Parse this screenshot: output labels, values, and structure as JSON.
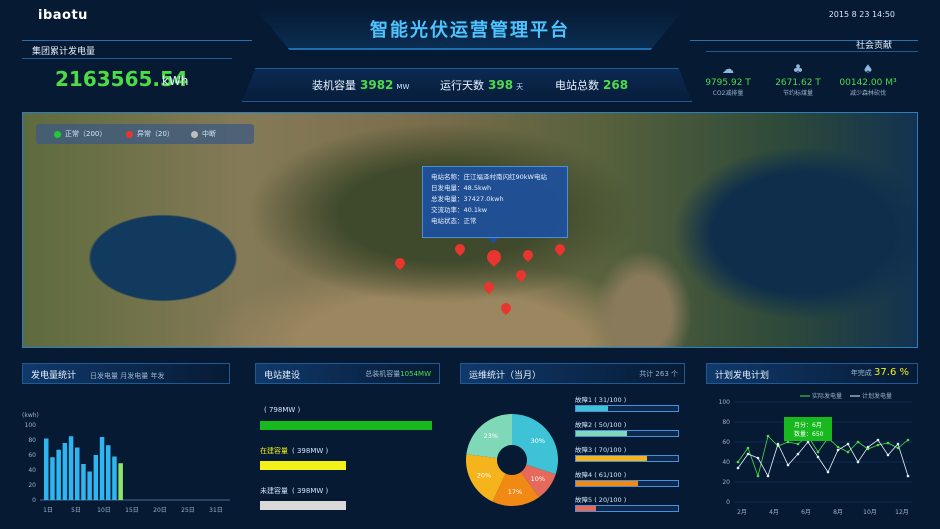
{
  "header": {
    "logo": "ibaotu",
    "title": "智能光伏运营管理平台",
    "datetime": "2015 8 23 14:50"
  },
  "left_stat": {
    "label": "集团累计发电量",
    "value": "2163565.54",
    "unit": "kWh"
  },
  "stats": [
    {
      "label": "装机容量",
      "value": "3982",
      "unit": "MW"
    },
    {
      "label": "运行天数",
      "value": "398",
      "unit": "天"
    },
    {
      "label": "电站总数",
      "value": "268",
      "unit": ""
    }
  ],
  "social": {
    "label": "社会贡献",
    "items": [
      {
        "icon": "cloud-icon",
        "value": "9795.92 T",
        "caption": "CO2减排量"
      },
      {
        "icon": "tree-icon",
        "value": "2671.62 T",
        "caption": "节约标煤量"
      },
      {
        "icon": "forest-icon",
        "value": "00142.00 M³",
        "caption": "减少森林砍伐"
      }
    ]
  },
  "map": {
    "legend": [
      {
        "label": "正常（200）",
        "color": "#22c93a"
      },
      {
        "label": "异常（20）",
        "color": "#e8352e"
      },
      {
        "label": "中断",
        "color": "#bfbfbf"
      }
    ],
    "tooltip": [
      "电站名称：庄江福泽村南闪红90kW电站",
      "日发电量：48.5kwh",
      "总发电量：37427.0kwh",
      "交流功率：40.1kw",
      "电站状态：正常"
    ]
  },
  "panels": {
    "generation": {
      "title": "发电量统计",
      "tabs": "日发电量    月发电量  年发"
    },
    "construction": {
      "title": "电站建设",
      "subtitle_prefix": "总装机容量",
      "subtitle_value": "1054MW"
    },
    "ops": {
      "title": "运维统计（当月）",
      "total": "共计 263 个"
    },
    "plan": {
      "title": "计划发电计划",
      "rate_label": "年完成",
      "rate_value": "37.6 %"
    }
  },
  "chart_data": [
    {
      "type": "bar",
      "ylabel": "(kwh)",
      "ylim": [
        0,
        100
      ],
      "yticks": [
        0,
        20,
        40,
        60,
        80,
        100
      ],
      "xticks": [
        "1日",
        "5日",
        "10日",
        "15日",
        "20日",
        "25日",
        "31日"
      ],
      "values": [
        82,
        57,
        67,
        76,
        85,
        70,
        48,
        38,
        60,
        84,
        73,
        58,
        49
      ]
    },
    {
      "type": "bar",
      "orientation": "horizontal",
      "rows": [
        {
          "label": "",
          "value_text": "( 798MW )",
          "value": 798,
          "color": "#18b81f"
        },
        {
          "label": "在建容量",
          "value_text": "( 398MW )",
          "value": 398,
          "color": "#f2f21a"
        },
        {
          "label": "未建容量",
          "value_text": "( 398MW )",
          "value": 398,
          "color": "#d9d9d9"
        }
      ]
    },
    {
      "type": "pie",
      "slices": [
        {
          "label": "30%",
          "value": 30,
          "color": "#3ec3d6"
        },
        {
          "label": "10%",
          "value": 10,
          "color": "#e56a5b"
        },
        {
          "label": "17%",
          "value": 17,
          "color": "#f08a14"
        },
        {
          "label": "20%",
          "value": 20,
          "color": "#f5b41c"
        },
        {
          "label": "23%",
          "value": 23,
          "color": "#7fd9b8"
        }
      ]
    },
    {
      "type": "bar",
      "orientation": "horizontal",
      "rows": [
        {
          "label": "故障1 ( 31/100 )",
          "value": 31,
          "color": "#3ec3d6"
        },
        {
          "label": "故障2 ( 50/100 )",
          "value": 50,
          "color": "#7fd9b8"
        },
        {
          "label": "故障3 ( 70/100 )",
          "value": 70,
          "color": "#f5b41c"
        },
        {
          "label": "故障4 ( 61/100 )",
          "value": 61,
          "color": "#f08a14"
        },
        {
          "label": "故障5 ( 20/100 )",
          "value": 20,
          "color": "#e56a5b"
        }
      ]
    },
    {
      "type": "line",
      "legend": [
        "实际发电量",
        "计划发电量"
      ],
      "ylim": [
        0,
        100
      ],
      "yticks": [
        0,
        20,
        40,
        60,
        80,
        100
      ],
      "xticks": [
        "2月",
        "4月",
        "6月",
        "8月",
        "10月",
        "12月"
      ],
      "series": [
        {
          "name": "实际发电量",
          "color": "#4ddc48",
          "values": [
            40,
            54,
            26,
            66,
            56,
            60,
            58,
            66,
            50,
            64,
            55,
            50,
            60,
            53,
            57,
            59,
            54,
            62
          ]
        },
        {
          "name": "计划发电量",
          "color": "#e6f2ff",
          "values": [
            34,
            48,
            44,
            26,
            58,
            37,
            48,
            60,
            45,
            30,
            52,
            58,
            40,
            55,
            62,
            47,
            58,
            26
          ]
        }
      ],
      "callout": {
        "line1": "月分：6月",
        "line2": "数量：650"
      }
    }
  ]
}
